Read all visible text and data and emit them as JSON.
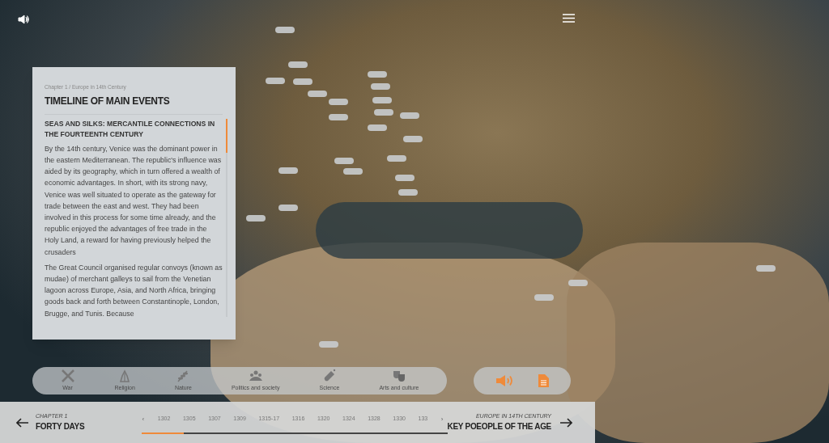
{
  "panel": {
    "breadcrumb": "Chapter 1 / Europe in 14th Century",
    "title": "TIMELINE OF MAIN EVENTS",
    "section_heading": "SEAS AND SILKS: MERCANTILE CONNECTIONS IN THE FOURTEENTH CENTURY",
    "paragraphs": [
      "By the 14th century, Venice was the dominant power in the eastern Mediterranean. The republic's influence was aided by its geography, which in turn offered a wealth of economic advantages. In short, with its strong navy, Venice was well situated to operate as the gateway for trade between the east and west. They had been involved in this process for some time already, and the republic enjoyed the advantages of free trade in the Holy Land, a reward for having previously helped the crusaders",
      "The Great Council organised regular convoys (known as mudae) of merchant galleys to sail from the Venetian lagoon across Europe, Asia, and North Africa, bringing goods back and forth between Constantinople, London, Brugge, and Tunis. Because"
    ]
  },
  "categories": [
    {
      "kind": "war",
      "label": "War"
    },
    {
      "kind": "religion",
      "label": "Religion"
    },
    {
      "kind": "nature",
      "label": "Nature"
    },
    {
      "kind": "politics",
      "label": "Politics and society"
    },
    {
      "kind": "science",
      "label": "Science"
    },
    {
      "kind": "arts",
      "label": "Arts and culture"
    }
  ],
  "footer": {
    "previous": {
      "overline": "CHAPTER 1",
      "title": "FORTY DAYS"
    },
    "timeline": {
      "prev": "‹",
      "next": "›",
      "years": [
        "1302",
        "1305",
        "1307",
        "1309",
        "1315-17",
        "1316",
        "1320",
        "1324",
        "1328",
        "1330",
        "133"
      ],
      "level": 0.14
    },
    "next": {
      "overline": "EUROPE IN 14TH CENTURY",
      "title": "KEY POEOPLE OF THE AGE"
    }
  }
}
